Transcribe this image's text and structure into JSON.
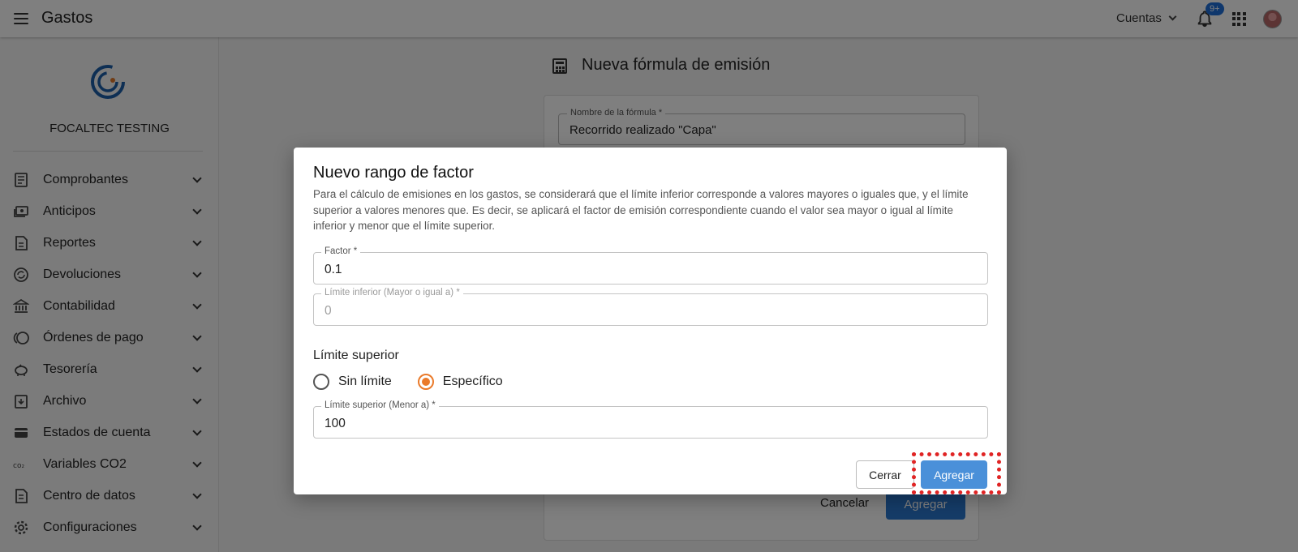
{
  "appbar": {
    "title": "Gastos",
    "accounts_label": "Cuentas",
    "notification_badge": "9+"
  },
  "sidebar": {
    "company": "FOCALTEC TESTING",
    "items": [
      {
        "label": "Comprobantes",
        "icon": "receipt-icon"
      },
      {
        "label": "Anticipos",
        "icon": "cash-icon"
      },
      {
        "label": "Reportes",
        "icon": "report-icon"
      },
      {
        "label": "Devoluciones",
        "icon": "refund-icon"
      },
      {
        "label": "Contabilidad",
        "icon": "bank-icon"
      },
      {
        "label": "Órdenes de pago",
        "icon": "coins-icon"
      },
      {
        "label": "Tesorería",
        "icon": "piggy-bank-icon"
      },
      {
        "label": "Archivo",
        "icon": "archive-icon"
      },
      {
        "label": "Estados de cuenta",
        "icon": "card-icon"
      },
      {
        "label": "Variables CO2",
        "icon": "co2-icon"
      },
      {
        "label": "Centro de datos",
        "icon": "data-center-icon"
      },
      {
        "label": "Configuraciones",
        "icon": "gear-icon"
      }
    ]
  },
  "page": {
    "title": "Nueva fórmula de emisión",
    "formula_name_label": "Nombre de la fórmula *",
    "formula_name_value": "Recorrido realizado \"Capa\"",
    "cancel_label": "Cancelar",
    "add_label": "Agregar"
  },
  "dialog": {
    "title": "Nuevo rango de factor",
    "description": "Para el cálculo de emisiones en los gastos, se considerará que el límite inferior corresponde a valores mayores o iguales que, y el límite superior a valores menores que. Es decir, se aplicará el factor de emisión correspondiente cuando el valor sea mayor o igual al límite inferior y menor que el límite superior.",
    "factor_label": "Factor *",
    "factor_value": "0.1",
    "lower_label": "Límite inferior (Mayor o igual a) *",
    "lower_value": "0",
    "upper_section": "Límite superior",
    "radio_none": "Sin límite",
    "radio_specific": "Específico",
    "upper_label": "Límite superior (Menor a) *",
    "upper_value": "100",
    "close_label": "Cerrar",
    "add_label": "Agregar"
  },
  "colors": {
    "accent": "#ea7a2a",
    "primary": "#4a90d9",
    "highlight": "#e02424"
  }
}
